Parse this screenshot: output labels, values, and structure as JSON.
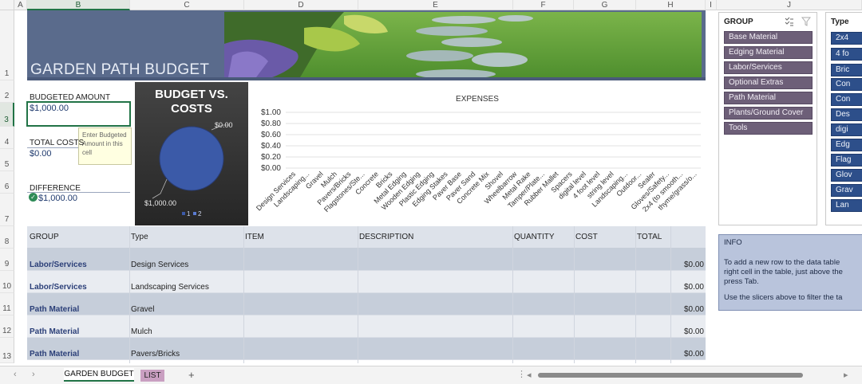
{
  "columns": [
    "A",
    "B",
    "C",
    "D",
    "E",
    "F",
    "G",
    "H",
    "I",
    "J"
  ],
  "rows": [
    "1",
    "2",
    "3",
    "4",
    "5",
    "6",
    "7",
    "8",
    "9",
    "10",
    "11",
    "12",
    "13"
  ],
  "banner": {
    "title": "GARDEN PATH BUDGET"
  },
  "budget": {
    "budgeted_label": "BUDGETED AMOUNT",
    "budgeted_value": "$1,000.00",
    "tooltip": "Enter Budgeted Amount in this cell",
    "total_costs_label": "TOTAL COSTS",
    "total_costs_value": "$0.00",
    "difference_label": "DIFFERENCE",
    "difference_value": "$1,000.00"
  },
  "chart_data": [
    {
      "type": "pie",
      "title": "BUDGET VS. COSTS",
      "categories": [
        "1",
        "2"
      ],
      "values": [
        1000,
        0
      ],
      "data_labels": [
        "$1,000.00",
        "$0.00"
      ],
      "legend": [
        "1",
        "2"
      ],
      "legend_position": "bottom",
      "colors": [
        "#3b5aa8",
        "#5a7bd0"
      ]
    },
    {
      "type": "bar",
      "title": "EXPENSES",
      "categories": [
        "Design Services",
        "Landscaping...",
        "Gravel",
        "Mulch",
        "Pavers/Bricks",
        "Flagstones/Ste...",
        "Concrete",
        "Bricks",
        "Metal Edging",
        "Wooden Edging",
        "Plastic Edging",
        "Edging Stakes",
        "Paver Base",
        "Paver Sand",
        "Concrete Mix",
        "Shovel",
        "Wheelbarrow",
        "Metal Rake",
        "Tamper/Plate...",
        "Rubber Mallet",
        "Spacers",
        "digital level",
        "4 foot level",
        "string level",
        "Landscaping...",
        "Outdoor...",
        "Sealer",
        "Gloves/Safety...",
        "2x4 (to smooth...",
        "thyme/grass/o..."
      ],
      "values": [
        0,
        0,
        0,
        0,
        0,
        0,
        0,
        0,
        0,
        0,
        0,
        0,
        0,
        0,
        0,
        0,
        0,
        0,
        0,
        0,
        0,
        0,
        0,
        0,
        0,
        0,
        0,
        0,
        0,
        0
      ],
      "y_ticks": [
        "$1.00",
        "$0.80",
        "$0.60",
        "$0.40",
        "$0.20",
        "$0.00"
      ],
      "ylim": [
        0,
        1
      ],
      "grid": true
    }
  ],
  "table": {
    "headers": [
      "GROUP",
      "Type",
      "ITEM",
      "DESCRIPTION",
      "QUANTITY",
      "COST",
      "TOTAL"
    ],
    "rows": [
      {
        "group": "Labor/Services",
        "type": "Design Services",
        "total": "$0.00"
      },
      {
        "group": "Labor/Services",
        "type": "Landscaping Services",
        "total": "$0.00"
      },
      {
        "group": "Path Material",
        "type": "Gravel",
        "total": "$0.00"
      },
      {
        "group": "Path Material",
        "type": "Mulch",
        "total": "$0.00"
      },
      {
        "group": "Path Material",
        "type": "Pavers/Bricks",
        "total": "$0.00"
      }
    ]
  },
  "slicer_group": {
    "title": "GROUP",
    "items": [
      "Base Material",
      "Edging Material",
      "Labor/Services",
      "Optional Extras",
      "Path Material",
      "Plants/Ground Cover",
      "Tools"
    ]
  },
  "slicer_type": {
    "title": "Type",
    "items": [
      "2x4",
      "4 fo",
      "Bric",
      "Con",
      "Con",
      "Des",
      "digi",
      "Edg",
      "Flag",
      "Glov",
      "Grav",
      "Lan"
    ]
  },
  "info": {
    "title": "INFO",
    "lines": [
      "To add a new row to the data table",
      "right cell in the table, just above the",
      "press Tab.",
      "Use the slicers above to filter the ta"
    ]
  },
  "tabs": {
    "active": "GARDEN BUDGET",
    "other": "LIST",
    "add": "+"
  },
  "icons": {
    "multiselect": "multi-select-icon",
    "clear_filter": "clear-filter-icon"
  }
}
